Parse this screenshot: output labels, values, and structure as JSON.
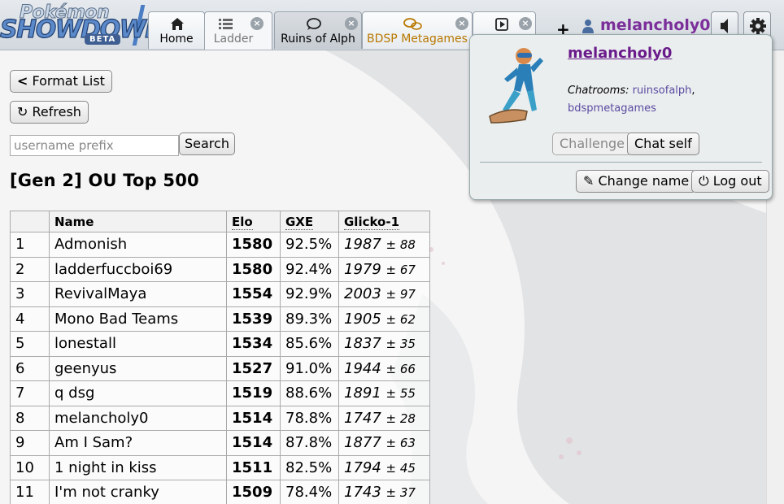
{
  "header": {
    "logo": {
      "top": "Pokémon",
      "main": "SHOWDOWN!",
      "badge": "BETA"
    },
    "tabs": [
      {
        "label": "Home",
        "icon": "home-icon"
      },
      {
        "label": "Ladder",
        "icon": "list-icon"
      },
      {
        "label": "Ruins of Alph",
        "icon": "speech-bubble-icon"
      },
      {
        "label": "BDSP Metagames",
        "icon": "speech-bubbles-icon"
      },
      {
        "label": "",
        "icon": "battle-icon"
      }
    ],
    "username": "melancholy0"
  },
  "controls": {
    "format_list": "Format List",
    "refresh": "Refresh",
    "search_placeholder": "username prefix",
    "search_button": "Search"
  },
  "ladder": {
    "title": "[Gen 2] OU Top 500",
    "columns": [
      "",
      "Name",
      "Elo",
      "GXE",
      "Glicko-1"
    ],
    "rows": [
      {
        "rank": "1",
        "name": "Admonish",
        "elo": "1580",
        "gxe": "92.5%",
        "glicko": "1987",
        "dev": "± 88"
      },
      {
        "rank": "2",
        "name": "ladderfuccboi69",
        "elo": "1580",
        "gxe": "92.4%",
        "glicko": "1979",
        "dev": "± 67"
      },
      {
        "rank": "3",
        "name": "RevivalMaya",
        "elo": "1554",
        "gxe": "92.9%",
        "glicko": "2003",
        "dev": "± 97"
      },
      {
        "rank": "4",
        "name": "Mono Bad Teams",
        "elo": "1539",
        "gxe": "89.3%",
        "glicko": "1905",
        "dev": "± 62"
      },
      {
        "rank": "5",
        "name": "lonestall",
        "elo": "1534",
        "gxe": "85.6%",
        "glicko": "1837",
        "dev": "± 35"
      },
      {
        "rank": "6",
        "name": "geenyus",
        "elo": "1527",
        "gxe": "91.0%",
        "glicko": "1944",
        "dev": "± 66"
      },
      {
        "rank": "7",
        "name": "q dsg",
        "elo": "1519",
        "gxe": "88.6%",
        "glicko": "1891",
        "dev": "± 55"
      },
      {
        "rank": "8",
        "name": "melancholy0",
        "elo": "1514",
        "gxe": "78.8%",
        "glicko": "1747",
        "dev": "± 28"
      },
      {
        "rank": "9",
        "name": "Am I Sam?",
        "elo": "1514",
        "gxe": "87.8%",
        "glicko": "1877",
        "dev": "± 63"
      },
      {
        "rank": "10",
        "name": "1 night in kiss",
        "elo": "1511",
        "gxe": "82.5%",
        "glicko": "1794",
        "dev": "± 45"
      },
      {
        "rank": "11",
        "name": "I'm not cranky",
        "elo": "1509",
        "gxe": "78.4%",
        "glicko": "1743",
        "dev": "± 37"
      }
    ]
  },
  "popup": {
    "name": "melancholy0",
    "chatrooms_label": "Chatrooms:",
    "rooms": [
      "ruinsofalph",
      "bdspmetagames"
    ],
    "challenge": "Challenge",
    "chat_self": "Chat self",
    "change_name": "Change name",
    "log_out": "Log out"
  },
  "colors": {
    "username": "#7b2e9a",
    "bdsp_tab": "#b87800",
    "room_link": "#5a4aa0"
  }
}
